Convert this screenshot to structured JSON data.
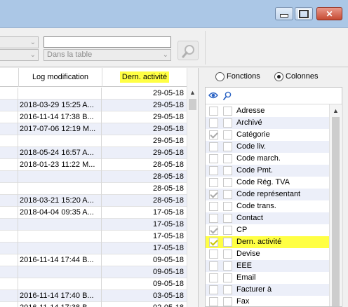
{
  "toolbar": {
    "combo_left": "",
    "combo_left2": "",
    "search_value": "",
    "scope_select": "Dans la table"
  },
  "grid": {
    "headers": [
      "",
      "Log modification",
      "Dern. activité"
    ],
    "rows": [
      {
        "log": "",
        "date": "29-05-18"
      },
      {
        "log": "2018-03-29 15:25 A...",
        "date": "29-05-18"
      },
      {
        "log": "2016-11-14 17:38 B...",
        "date": "29-05-18"
      },
      {
        "log": "2017-07-06 12:19 M...",
        "date": "29-05-18"
      },
      {
        "log": "",
        "date": "29-05-18"
      },
      {
        "log": "2018-05-24 16:57 A...",
        "date": "29-05-18"
      },
      {
        "log": "2018-01-23 11:22 M...",
        "date": "28-05-18"
      },
      {
        "log": "",
        "date": "28-05-18"
      },
      {
        "log": "",
        "date": "28-05-18"
      },
      {
        "log": "2018-03-21 15:20 A...",
        "date": "28-05-18"
      },
      {
        "log": "2018-04-04 09:35 A...",
        "date": "17-05-18"
      },
      {
        "log": "",
        "date": "17-05-18"
      },
      {
        "log": "",
        "date": "17-05-18"
      },
      {
        "log": "",
        "date": "17-05-18"
      },
      {
        "log": "2016-11-14 17:44 B...",
        "date": "09-05-18"
      },
      {
        "log": "",
        "date": "09-05-18"
      },
      {
        "log": "",
        "date": "09-05-18"
      },
      {
        "log": "2016-11-14 17:40 B...",
        "date": "03-05-18"
      },
      {
        "log": "2016-11-14 17:38 B...",
        "date": "02-05-18"
      }
    ]
  },
  "panel": {
    "radio_functions": "Fonctions",
    "radio_columns": "Colonnes",
    "columns_selected": true,
    "items": [
      {
        "label": "Adresse",
        "checked": false,
        "selected": false
      },
      {
        "label": "Archivé",
        "checked": false,
        "selected": false
      },
      {
        "label": "Catégorie",
        "checked": true,
        "selected": false
      },
      {
        "label": "Code liv.",
        "checked": false,
        "selected": false
      },
      {
        "label": "Code march.",
        "checked": false,
        "selected": false
      },
      {
        "label": "Code Pmt.",
        "checked": false,
        "selected": false
      },
      {
        "label": "Code Rég. TVA",
        "checked": false,
        "selected": false
      },
      {
        "label": "Code représentant",
        "checked": true,
        "selected": false
      },
      {
        "label": "Code trans.",
        "checked": false,
        "selected": false
      },
      {
        "label": "Contact",
        "checked": false,
        "selected": false
      },
      {
        "label": "CP",
        "checked": true,
        "selected": false
      },
      {
        "label": "Dern. activité",
        "checked": true,
        "selected": true
      },
      {
        "label": "Devise",
        "checked": false,
        "selected": false
      },
      {
        "label": "EEE",
        "checked": false,
        "selected": false
      },
      {
        "label": "Email",
        "checked": false,
        "selected": false
      },
      {
        "label": "Facturer à",
        "checked": false,
        "selected": false
      },
      {
        "label": "Fax",
        "checked": false,
        "selected": false
      }
    ]
  },
  "colors": {
    "highlight": "#ffff44",
    "alt_row": "#eceff9",
    "titlebar": "#abc7e6"
  }
}
